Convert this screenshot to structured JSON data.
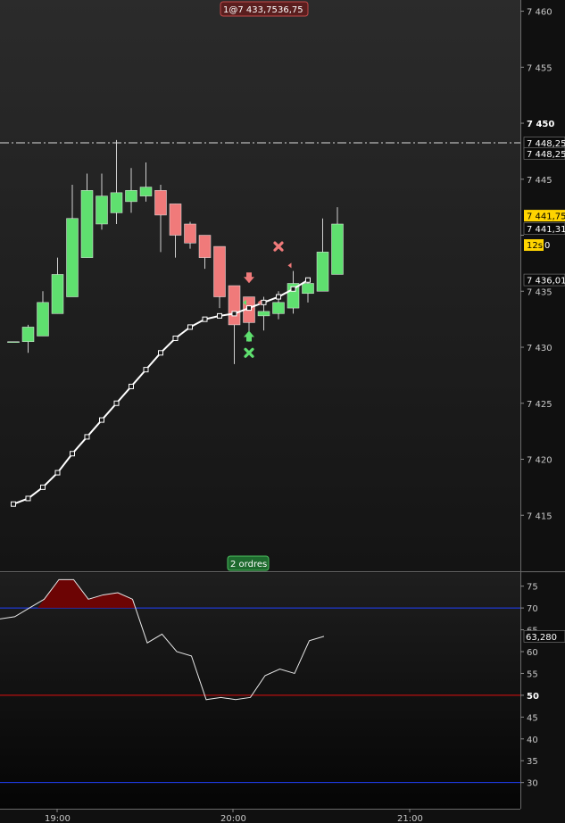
{
  "top_badge": "1@7 433,75 436,75",
  "orders_badge": "2 ordres",
  "timer_badge": "12s",
  "colors": {
    "background": "#0e0e0e",
    "up_candle": "#5fe06f",
    "down_candle": "#f07a7a",
    "ma_line": "#ffffff",
    "current_price_bg": "#ffd400",
    "rsi_line": "#e8e8e8",
    "rsi_fill": "#7a0000",
    "level_70_30": "#2040ff",
    "level_50": "#e01010"
  },
  "chart_data": [
    {
      "type": "candlestick",
      "title": "",
      "y_range": [
        7410,
        7461
      ],
      "x_labels": [
        "19:00",
        "20:00",
        "21:00"
      ],
      "y_ticks": [
        {
          "value": 7460,
          "label": "7 460"
        },
        {
          "value": 7455,
          "label": "7 455"
        },
        {
          "value": 7450,
          "label": "7 450",
          "bold": true
        },
        {
          "value": 7445,
          "label": "7 445"
        },
        {
          "value": 7440,
          "label": ""
        },
        {
          "value": 7435,
          "label": "7 435"
        },
        {
          "value": 7430,
          "label": "7 430"
        },
        {
          "value": 7425,
          "label": "7 425"
        },
        {
          "value": 7420,
          "label": "7 420"
        },
        {
          "value": 7415,
          "label": "7 415"
        }
      ],
      "price_labels": [
        {
          "value": 7448.25,
          "label": "7 448,25",
          "style": "dark"
        },
        {
          "value": 7447.3,
          "label": "7 448,25",
          "style": "dark"
        },
        {
          "value": 7441.75,
          "label": "7 441,75",
          "style": "current"
        },
        {
          "value": 7440.6,
          "label": "7 441,31",
          "style": "dark"
        },
        {
          "value": 7436.01,
          "label": "7 436,01",
          "style": "dark"
        }
      ],
      "dash_dot_level": 7448.25,
      "candles": [
        {
          "o": 7430.5,
          "h": 7430.5,
          "l": 7430.5,
          "c": 7430.5
        },
        {
          "o": 7430.5,
          "h": 7432.0,
          "l": 7429.5,
          "c": 7431.8
        },
        {
          "o": 7431.0,
          "h": 7435.0,
          "l": 7431.0,
          "c": 7434.0
        },
        {
          "o": 7433.0,
          "h": 7438.0,
          "l": 7433.0,
          "c": 7436.5
        },
        {
          "o": 7434.5,
          "h": 7444.5,
          "l": 7434.5,
          "c": 7441.5
        },
        {
          "o": 7438.0,
          "h": 7445.5,
          "l": 7438.0,
          "c": 7444.0
        },
        {
          "o": 7441.0,
          "h": 7445.5,
          "l": 7440.5,
          "c": 7443.5
        },
        {
          "o": 7442.0,
          "h": 7448.5,
          "l": 7441.0,
          "c": 7443.8
        },
        {
          "o": 7443.0,
          "h": 7446.0,
          "l": 7442.0,
          "c": 7444.0
        },
        {
          "o": 7443.5,
          "h": 7446.5,
          "l": 7443.0,
          "c": 7444.3
        },
        {
          "o": 7444.0,
          "h": 7444.5,
          "l": 7438.5,
          "c": 7441.8
        },
        {
          "o": 7442.8,
          "h": 7442.8,
          "l": 7438.0,
          "c": 7440.0
        },
        {
          "o": 7441.0,
          "h": 7441.2,
          "l": 7438.8,
          "c": 7439.3
        },
        {
          "o": 7440.0,
          "h": 7440.0,
          "l": 7437.0,
          "c": 7438.0
        },
        {
          "o": 7439.0,
          "h": 7439.0,
          "l": 7433.5,
          "c": 7434.5
        },
        {
          "o": 7435.5,
          "h": 7435.5,
          "l": 7428.5,
          "c": 7432.0
        },
        {
          "o": 7434.5,
          "h": 7434.5,
          "l": 7430.5,
          "c": 7432.2
        },
        {
          "o": 7432.8,
          "h": 7434.5,
          "l": 7431.5,
          "c": 7433.2
        },
        {
          "o": 7433.0,
          "h": 7435.0,
          "l": 7432.5,
          "c": 7434.0
        },
        {
          "o": 7433.5,
          "h": 7436.8,
          "l": 7433.0,
          "c": 7435.7
        },
        {
          "o": 7434.8,
          "h": 7435.8,
          "l": 7434.0,
          "c": 7435.7
        },
        {
          "o": 7435.0,
          "h": 7441.5,
          "l": 7435.0,
          "c": 7438.5
        },
        {
          "o": 7436.5,
          "h": 7442.5,
          "l": 7436.5,
          "c": 7441.0
        }
      ],
      "moving_average": [
        7416.0,
        7416.5,
        7417.5,
        7418.8,
        7420.5,
        7422.0,
        7423.5,
        7425.0,
        7426.5,
        7428.0,
        7429.5,
        7430.8,
        7431.8,
        7432.5,
        7432.8,
        7433.0,
        7433.5,
        7434.0,
        7434.5,
        7435.2,
        7436.0
      ],
      "moving_average_start_index": 0,
      "markers": [
        {
          "index": 16,
          "type": "arrow-down",
          "value": 7436.2,
          "color": "#f07a7a"
        },
        {
          "index": 16,
          "type": "arrow-up",
          "value": 7431.0,
          "color": "#5fe06f"
        },
        {
          "index": 16,
          "type": "cross",
          "value": 7429.5,
          "color": "#5fe06f"
        },
        {
          "index": 18,
          "type": "cross",
          "value": 7439.0,
          "color": "#f07a7a"
        }
      ]
    },
    {
      "type": "line",
      "title": "",
      "y_range": [
        24,
        78
      ],
      "y_ticks": [
        75,
        70,
        65,
        60,
        55,
        50,
        45,
        40,
        35,
        30
      ],
      "levels": [
        70,
        50,
        30
      ],
      "current_value_label": "63,280",
      "values": [
        67.5,
        68.0,
        70.0,
        72.0,
        76.5,
        76.5,
        72.0,
        73.0,
        73.5,
        72.0,
        62.0,
        64.0,
        60.0,
        59.0,
        49.0,
        49.5,
        49.0,
        49.5,
        54.5,
        56.0,
        55.0,
        62.5,
        63.5
      ]
    }
  ]
}
